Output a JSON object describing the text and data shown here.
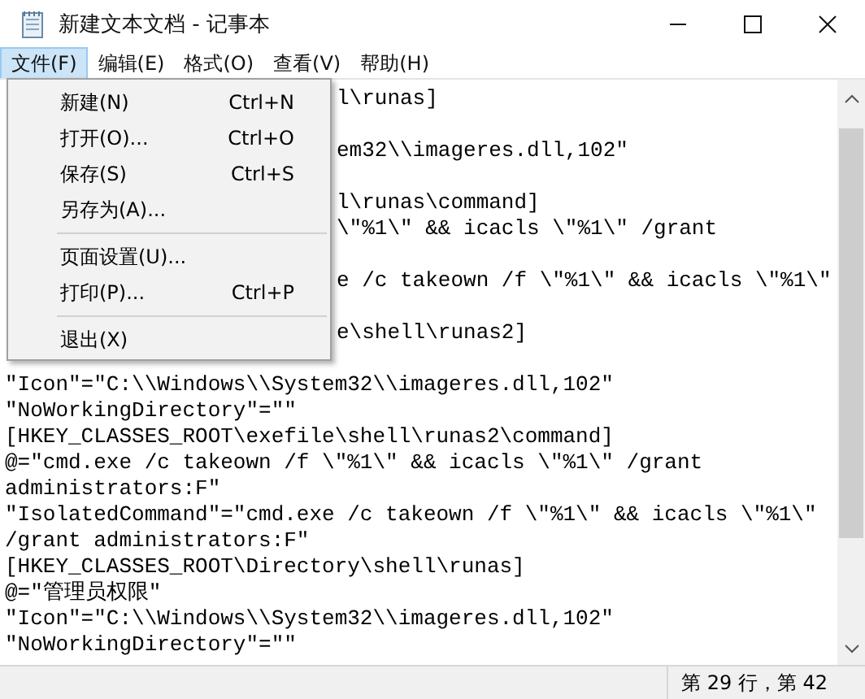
{
  "window": {
    "title": "新建文本文档 - 记事本"
  },
  "menu_bar": [
    {
      "label": "文件(F)",
      "selected": true
    },
    {
      "label": "编辑(E)",
      "selected": false
    },
    {
      "label": "格式(O)",
      "selected": false
    },
    {
      "label": "查看(V)",
      "selected": false
    },
    {
      "label": "帮助(H)",
      "selected": false
    }
  ],
  "file_menu": [
    {
      "kind": "item",
      "label": "新建(N)",
      "shortcut": "Ctrl+N"
    },
    {
      "kind": "item",
      "label": "打开(O)...",
      "shortcut": "Ctrl+O"
    },
    {
      "kind": "item",
      "label": "保存(S)",
      "shortcut": "Ctrl+S"
    },
    {
      "kind": "item",
      "label": "另存为(A)..."
    },
    {
      "kind": "separator"
    },
    {
      "kind": "item",
      "label": "页面设置(U)..."
    },
    {
      "kind": "item",
      "label": "打印(P)...",
      "shortcut": "Ctrl+P"
    },
    {
      "kind": "separator"
    },
    {
      "kind": "item",
      "label": "退出(X)"
    }
  ],
  "editor_beside_menu": [
    [
      "l\\runas]"
    ],
    [
      "em32\\\\imageres.dll,102\""
    ],
    [
      "l\\runas\\command]",
      "\\\"%1\\\" && icacls \\\"%1\\\" /grant"
    ],
    [
      "e /c takeown /f \\\"%1\\\" && icacls \\\"%1\\\""
    ],
    [
      "e\\shell\\runas2]"
    ]
  ],
  "editor_lines": [
    "\"Icon\"=\"C:\\\\Windows\\\\System32\\\\imageres.dll,102\"",
    "\"NoWorkingDirectory\"=\"\"",
    "[HKEY_CLASSES_ROOT\\exefile\\shell\\runas2\\command]",
    "@=\"cmd.exe /c takeown /f \\\"%1\\\" && icacls \\\"%1\\\" /grant",
    "administrators:F\"",
    "\"IsolatedCommand\"=\"cmd.exe /c takeown /f \\\"%1\\\" && icacls \\\"%1\\\"",
    "/grant administrators:F\"",
    "[HKEY_CLASSES_ROOT\\Directory\\shell\\runas]",
    "@=\"管理员权限\"",
    "\"Icon\"=\"C:\\\\Windows\\\\System32\\\\imageres.dll,102\"",
    "\"NoWorkingDirectory\"=\"\""
  ],
  "status_bar": {
    "position": "第 29 行，第 42"
  }
}
